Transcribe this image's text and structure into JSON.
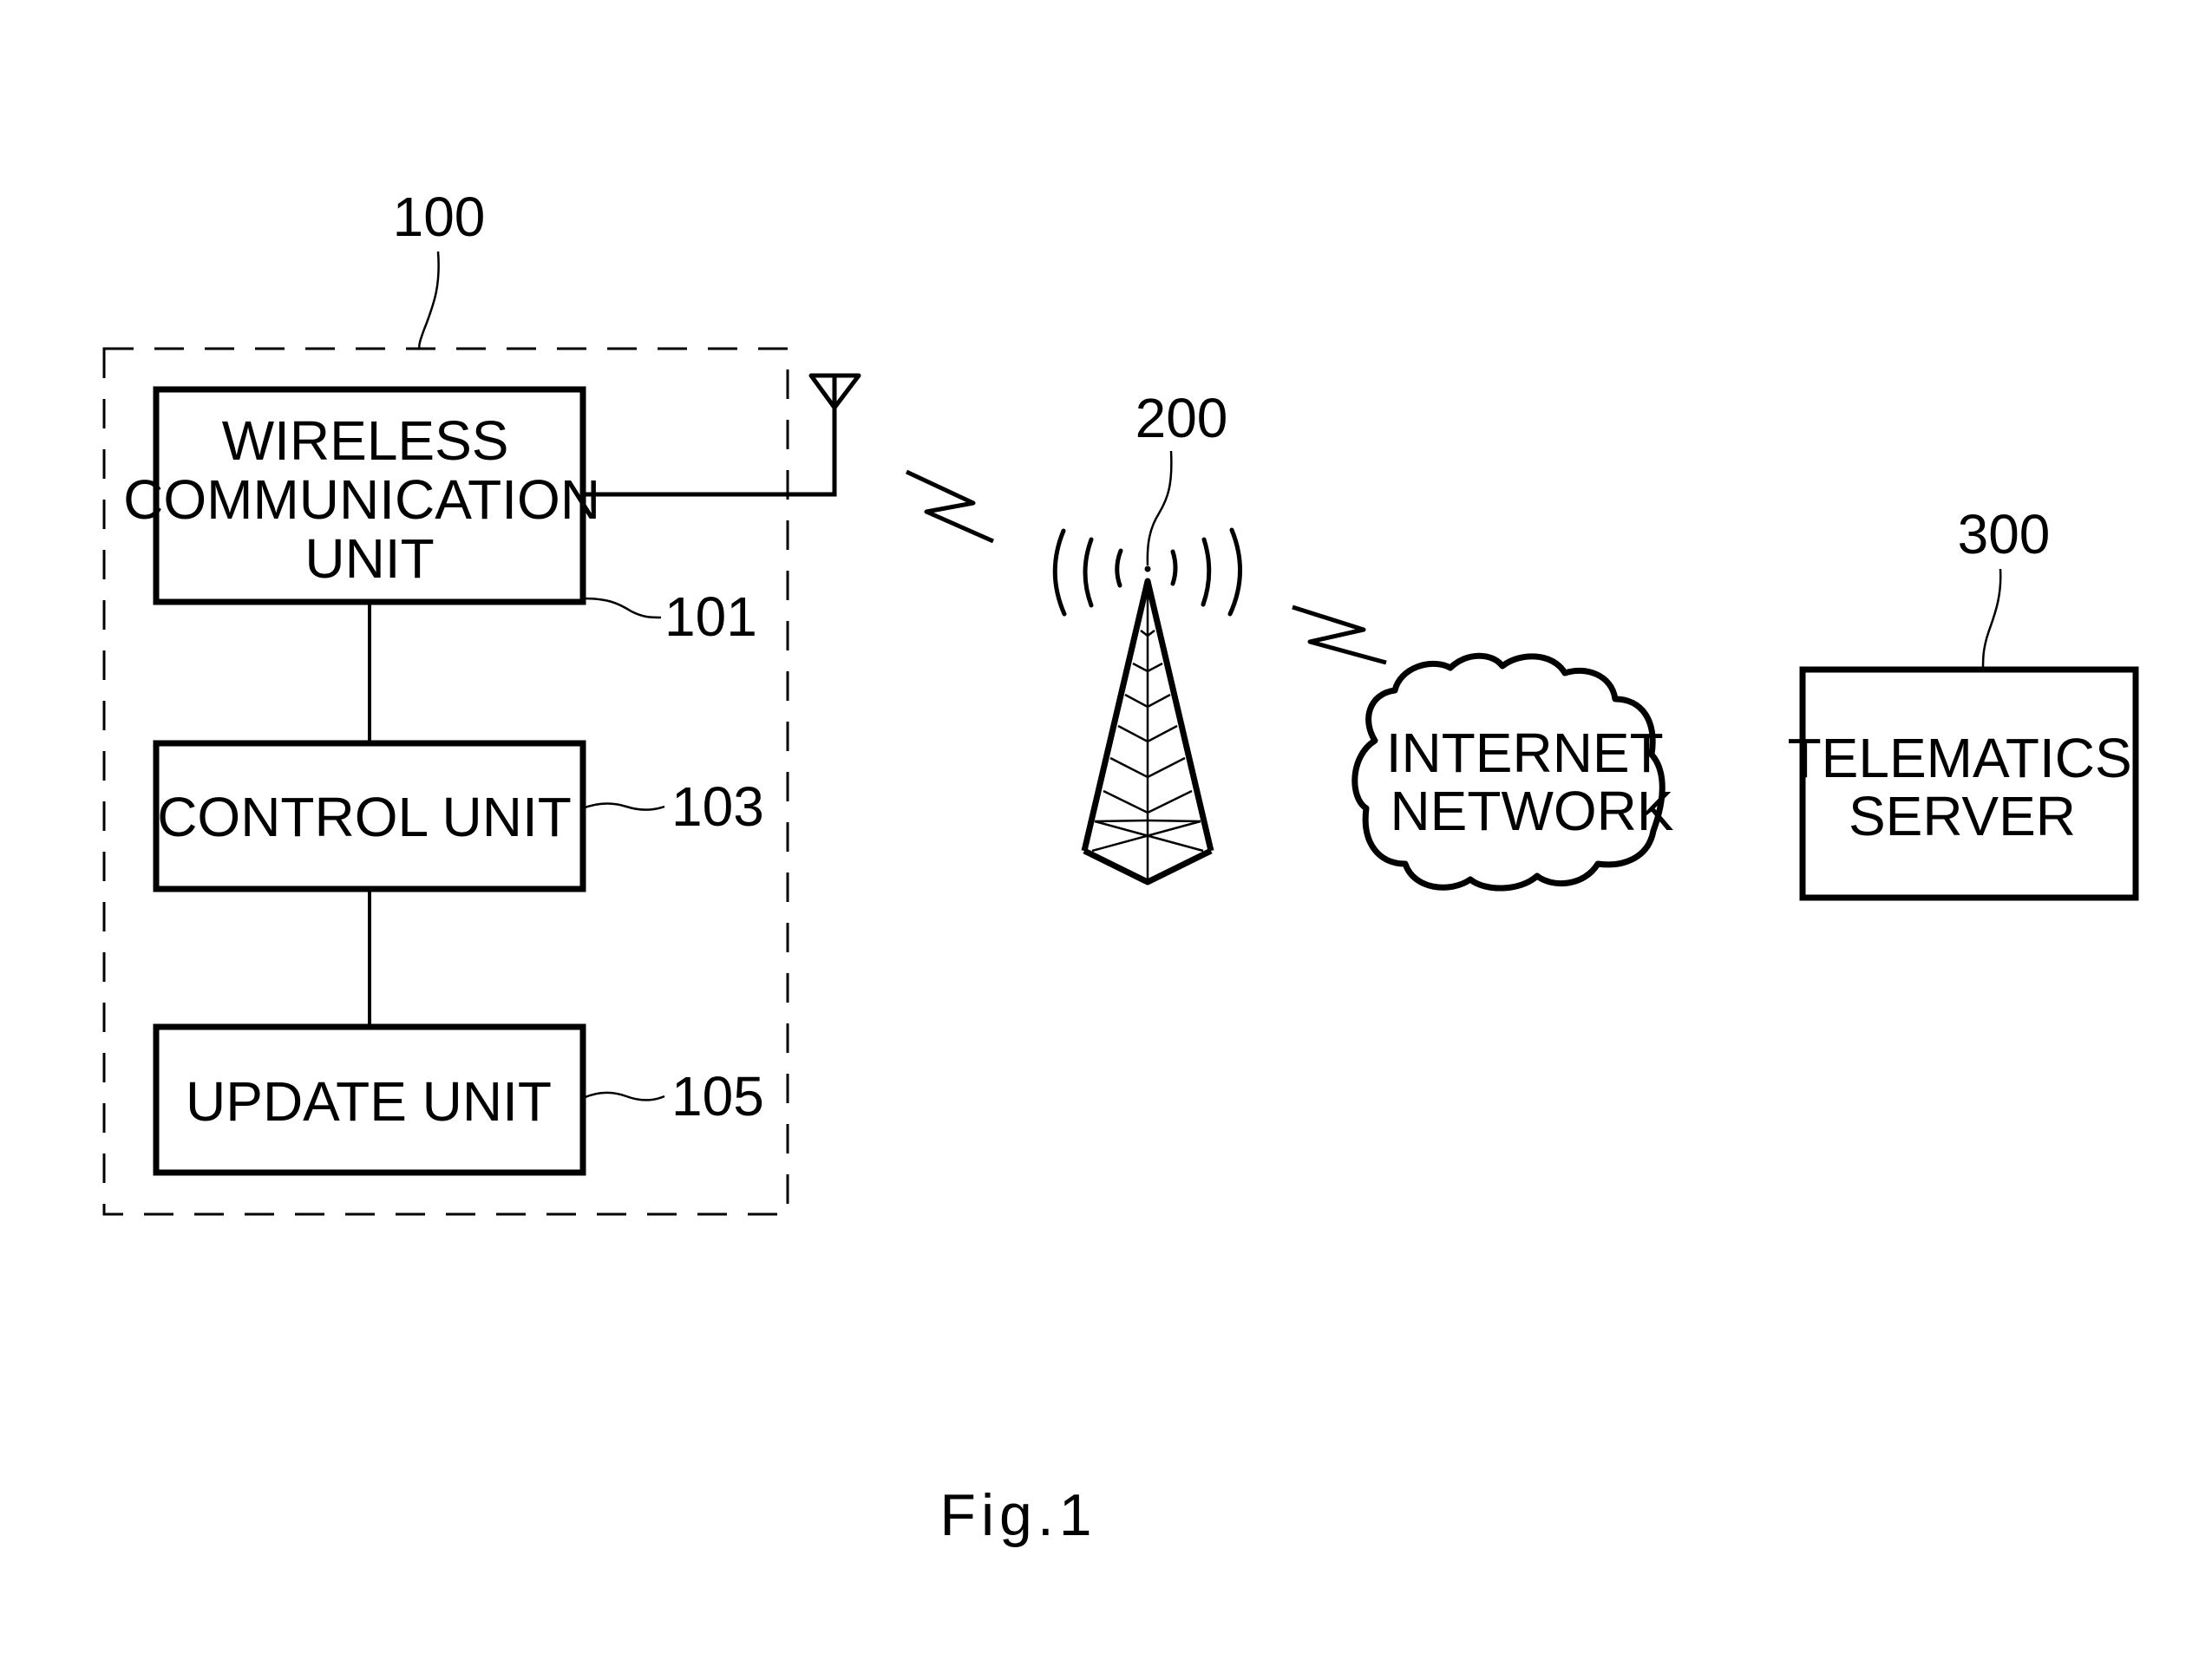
{
  "figure": {
    "caption": "Fig.1",
    "colors": {
      "line": "#000000",
      "background": "#ffffff"
    }
  },
  "vehicle_terminal": {
    "ref": "100",
    "blocks": [
      {
        "id": "wireless",
        "ref": "101",
        "lines": [
          "WIRELESS",
          "COMMUNICATION",
          "UNIT"
        ]
      },
      {
        "id": "control",
        "ref": "103",
        "lines": [
          "CONTROL UNIT"
        ]
      },
      {
        "id": "update",
        "ref": "105",
        "lines": [
          "UPDATE UNIT"
        ]
      }
    ]
  },
  "base_station": {
    "ref": "200"
  },
  "internet": {
    "lines": [
      "INTERNET",
      "NETWORK"
    ]
  },
  "server": {
    "ref": "300",
    "lines": [
      "TELEMATICS",
      "SERVER"
    ]
  }
}
